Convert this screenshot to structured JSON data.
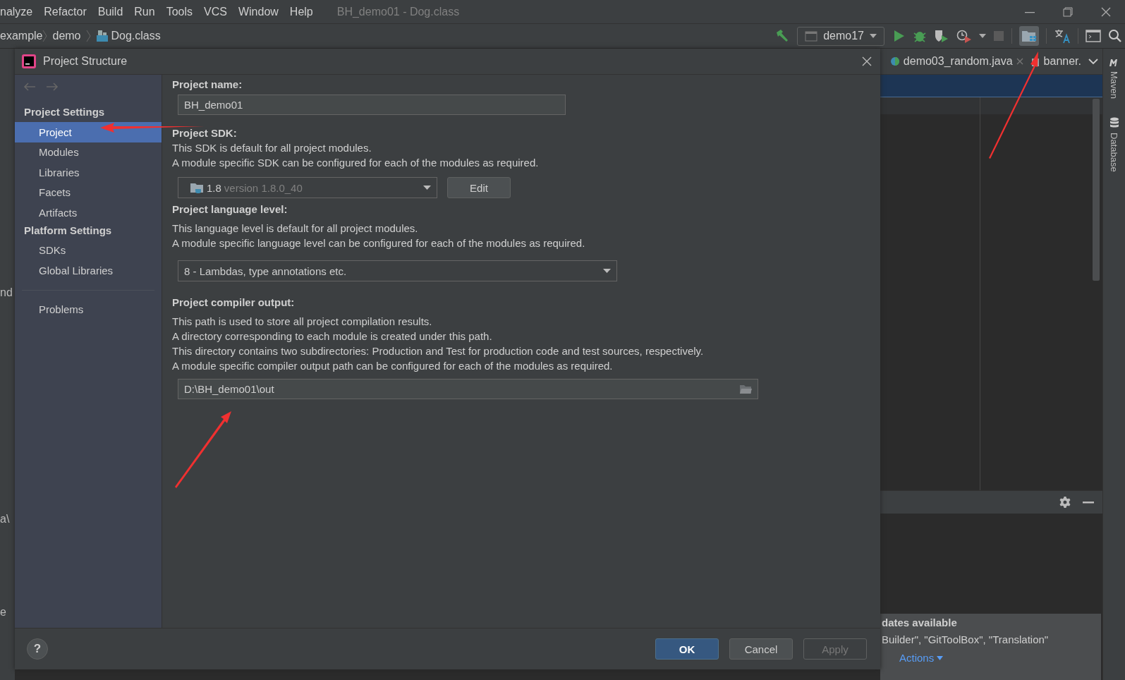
{
  "menu_bar": {
    "items": [
      "nalyze",
      "Refactor",
      "Build",
      "Run",
      "Tools",
      "VCS",
      "Window",
      "Help"
    ],
    "title": "BH_demo01 - Dog.class"
  },
  "breadcrumb": [
    "example",
    "demo",
    "Dog.class"
  ],
  "toolbar": {
    "run_configuration": "demo17"
  },
  "editor_tabs": [
    {
      "label": "demo03_random.java",
      "closable": true
    },
    {
      "label": "banner.",
      "closable": false
    }
  ],
  "right_tool_stripe": [
    "Maven",
    "Database"
  ],
  "left_edge_texts": [
    "nd",
    "a\\",
    "e"
  ],
  "dialog": {
    "title": "Project Structure",
    "sidebar": [
      {
        "heading": "Project Settings",
        "items": [
          {
            "label": "Project",
            "selected": true
          },
          {
            "label": "Modules",
            "selected": false
          },
          {
            "label": "Libraries",
            "selected": false
          },
          {
            "label": "Facets",
            "selected": false
          },
          {
            "label": "Artifacts",
            "selected": false
          }
        ]
      },
      {
        "heading": "Platform Settings",
        "items": [
          {
            "label": "SDKs",
            "selected": false
          },
          {
            "label": "Global Libraries",
            "selected": false
          }
        ]
      },
      {
        "items": [
          {
            "label": "Problems",
            "selected": false
          }
        ]
      }
    ],
    "project_name": {
      "label": "Project name:",
      "value": "BH_demo01"
    },
    "project_sdk": {
      "label": "Project SDK:",
      "description": [
        "This SDK is default for all project modules.",
        "A module specific SDK can be configured for each of the modules as required."
      ],
      "value": "1.8",
      "detail": "version 1.8.0_40",
      "button": "Edit"
    },
    "language_level": {
      "label": "Project language level:",
      "description": [
        "This language level is default for all project modules.",
        "A module specific language level can be configured for each of the modules as required."
      ],
      "value": "8 - Lambdas, type annotations etc."
    },
    "compiler_output": {
      "label": "Project compiler output:",
      "description": [
        "This path is used to store all project compilation results.",
        "A directory corresponding to each module is created under this path.",
        "This directory contains two subdirectories: Production and Test for production code and test sources, respectively.",
        "A module specific compiler output path can be configured for each of the modules as required."
      ],
      "value": "D:\\BH_demo01\\out"
    },
    "help_button": "?",
    "buttons": [
      {
        "label": "OK",
        "kind": "default"
      },
      {
        "label": "Cancel",
        "kind": "normal"
      },
      {
        "label": "Apply",
        "kind": "disabled"
      }
    ]
  },
  "notification": {
    "title": "dates available",
    "body": "Builder\", \"GitToolBox\", \"Translation\"",
    "link": "Actions"
  }
}
